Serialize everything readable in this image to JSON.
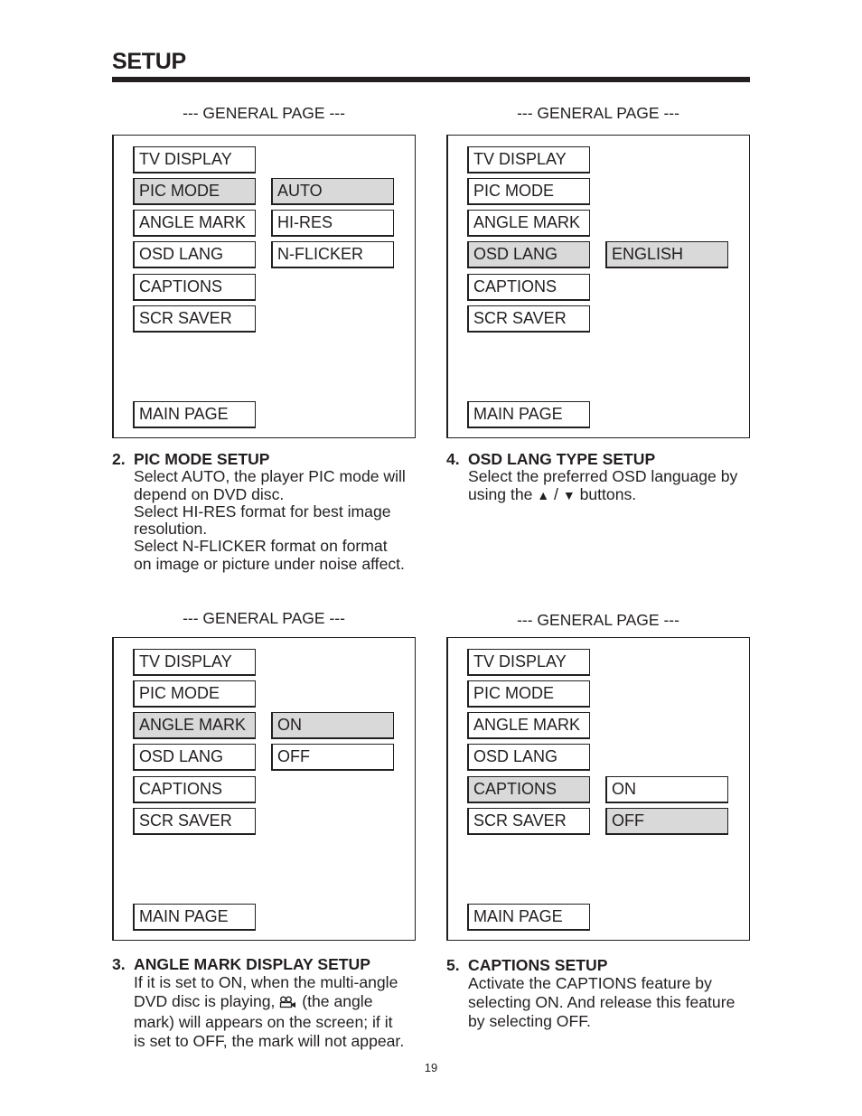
{
  "page": {
    "title": "SETUP",
    "page_number": "19"
  },
  "menu_labels": [
    "TV DISPLAY",
    "PIC MODE",
    "ANGLE MARK",
    "OSD LANG",
    "CAPTIONS",
    "SCR SAVER"
  ],
  "main_page_label": "MAIN PAGE",
  "panels": [
    {
      "caption": "--- GENERAL PAGE ---",
      "selected_item": "PIC MODE",
      "options": [
        {
          "label": "AUTO",
          "selected": true
        },
        {
          "label": "HI-RES",
          "selected": false
        },
        {
          "label": "N-FLICKER",
          "selected": false
        }
      ]
    },
    {
      "caption": "--- GENERAL PAGE ---",
      "selected_item": "OSD LANG",
      "options": [
        {
          "label": "ENGLISH",
          "selected": true
        }
      ]
    },
    {
      "caption": "--- GENERAL PAGE ---",
      "selected_item": "ANGLE MARK",
      "options": [
        {
          "label": "ON",
          "selected": true
        },
        {
          "label": "OFF",
          "selected": false
        }
      ]
    },
    {
      "caption": "--- GENERAL PAGE ---",
      "selected_item": "CAPTIONS",
      "options": [
        {
          "label": "ON",
          "selected": false
        },
        {
          "label": "OFF",
          "selected": true
        }
      ]
    }
  ],
  "sections": [
    {
      "number": "2.",
      "heading": "PIC MODE SETUP",
      "lines": [
        "Select AUTO, the player PIC mode will",
        "depend on DVD disc.",
        "Select HI-RES format for best image",
        "resolution.",
        "Select N-FLICKER format on format",
        "on image or picture under noise affect."
      ]
    },
    {
      "number": "4.",
      "heading": "OSD LANG TYPE SETUP",
      "line1": "Select the preferred OSD language by",
      "line2_pre": "using the",
      "up_icon": "▲",
      "slash": "/",
      "down_icon": "▼",
      "line2_post": "buttons."
    },
    {
      "number": "3.",
      "heading": "ANGLE MARK DISPLAY SETUP",
      "line1": "If it is set to ON, when the multi-angle",
      "line2_pre": "DVD disc is playing,",
      "angle_icon": "angle-mark-icon",
      "line2_post": "(the angle",
      "line3": "mark) will appears on the screen; if it",
      "line4": "is set to OFF, the mark will not appear."
    },
    {
      "number": "5.",
      "heading": "CAPTIONS SETUP",
      "lines": [
        "Activate the CAPTIONS feature by",
        "selecting ON.  And release this feature",
        "by selecting OFF."
      ]
    }
  ],
  "colors": {
    "ink": "#231f20",
    "highlight": "#d9d9d9"
  }
}
